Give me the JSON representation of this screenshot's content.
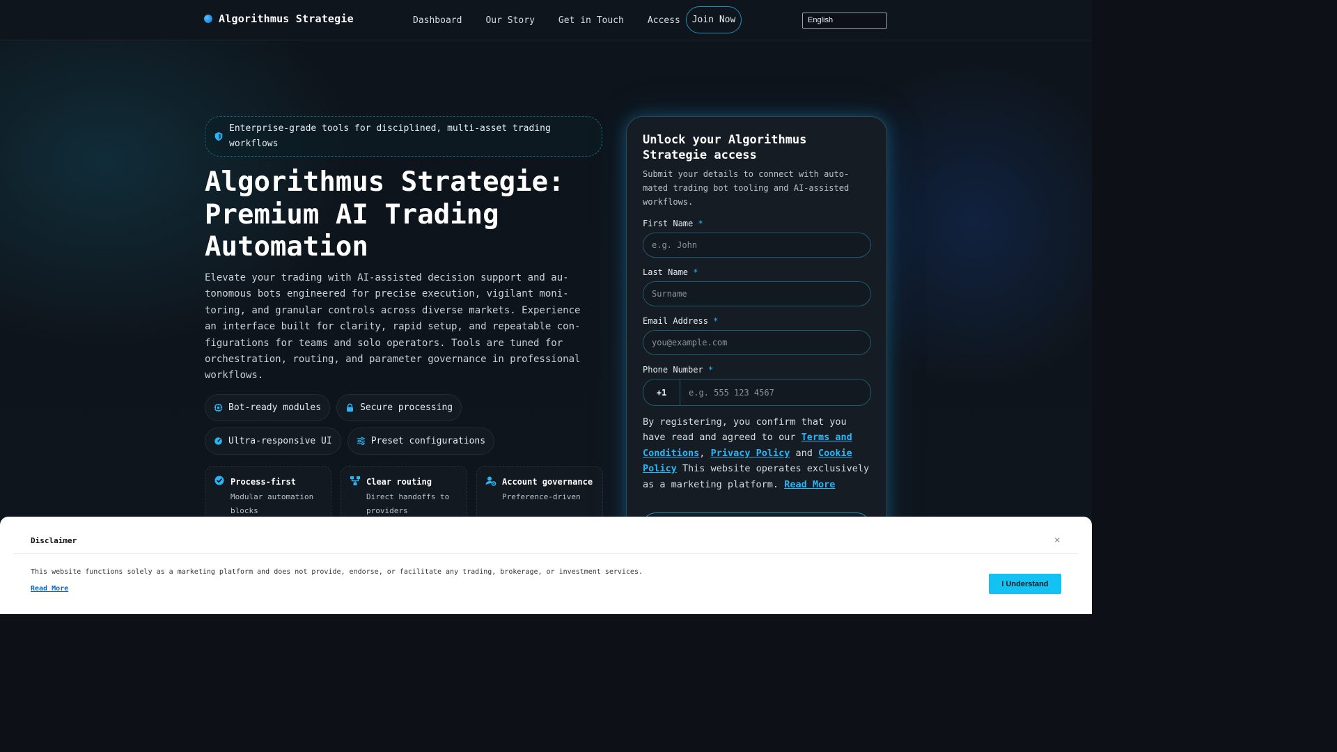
{
  "nav": {
    "brand": "Algorithmus Strategie",
    "links": [
      "Dashboard",
      "Our Story",
      "Get in Touch",
      "Access"
    ],
    "join": "Join Now",
    "language": "English"
  },
  "hero": {
    "pill": "Enterprise-grade tools for disciplined, multi-asset trading workflows",
    "title": "Algorithmus Strategie: Premium AI Trading Automation",
    "description": "Elevate your trading with AI-assisted decision support and au-tonomous bots engineered for precise execution, vigilant moni-toring, and granular controls across diverse markets. Experience an interface built for clarity, rapid setup, and repeatable con-figurations for teams and solo operators. Tools are tuned for orchestration, routing, and parameter governance in professional workflows.",
    "chips": [
      {
        "label": "Bot-ready modules",
        "icon": "chip-icon"
      },
      {
        "label": "Secure processing",
        "icon": "lock-icon"
      },
      {
        "label": "Ultra-responsive UI",
        "icon": "gauge-icon"
      },
      {
        "label": "Preset configurations",
        "icon": "sliders-icon"
      }
    ],
    "cards": [
      {
        "title": "Process-first",
        "sub": "Modular automation blocks",
        "icon": "check-circle-icon"
      },
      {
        "title": "Clear routing",
        "sub": "Direct handoffs to providers",
        "icon": "routing-icon"
      },
      {
        "title": "Account governance",
        "sub": "Preference-driven",
        "icon": "user-gear-icon"
      }
    ]
  },
  "form": {
    "title": "Unlock your Algorithmus Strategie access",
    "subtitle": "Submit your details to connect with auto-mated trading bot tooling and AI-assisted workflows.",
    "required_mark": "*",
    "first_name": {
      "label": "First Name",
      "placeholder": "e.g. John"
    },
    "last_name": {
      "label": "Last Name",
      "placeholder": "Surname"
    },
    "email": {
      "label": "Email Address",
      "placeholder": "you@example.com"
    },
    "phone": {
      "label": "Phone Number",
      "code": "+1",
      "placeholder": "e.g. 555 123 4567"
    },
    "consent": {
      "prefix": "By registering, you confirm that you have read and agreed to our",
      "terms": "Terms and Conditions",
      "comma": ",",
      "privacy": "Privacy Policy",
      "and": "and",
      "cookie": "Cookie Policy",
      "suffix": "This website operates exclusively as a marketing platform.",
      "read_more": "Read More"
    }
  },
  "disclaimer": {
    "title": "Disclaimer",
    "close": "×",
    "text": "This website functions solely as a marketing platform and does not provide, endorse, or facilitate any trading, brokerage, or investment services.",
    "read_more": "Read More",
    "button": "I Understand"
  },
  "colors": {
    "accent": "#29b6f6",
    "background": "#0d1117",
    "button": "#13c2f2"
  }
}
